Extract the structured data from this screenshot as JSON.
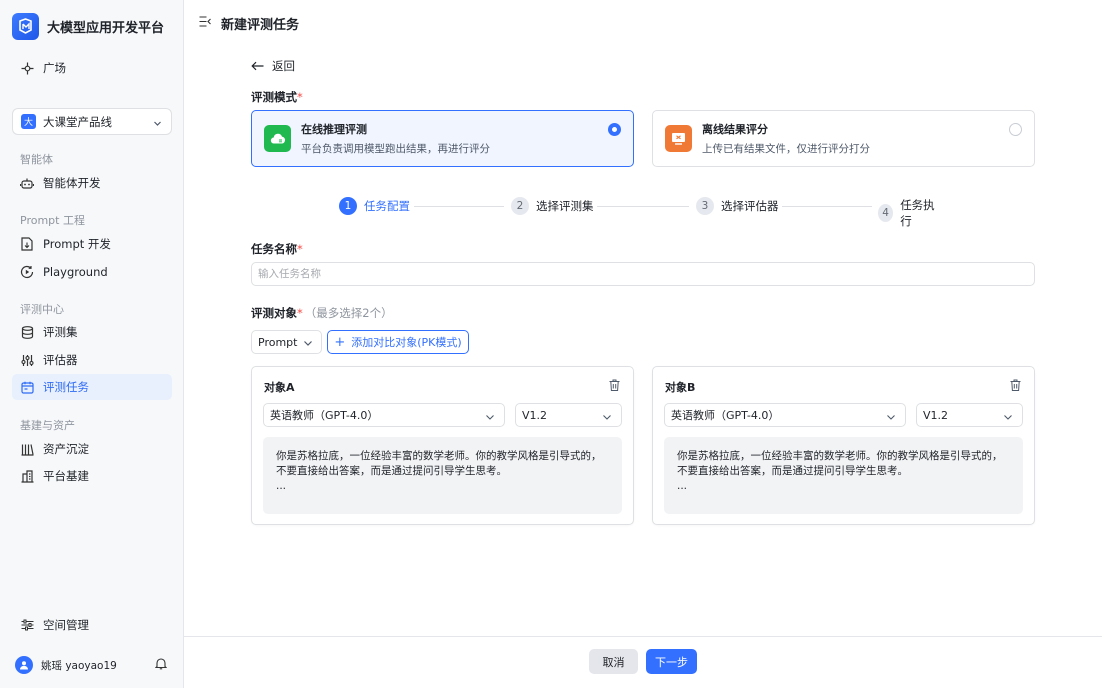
{
  "app": {
    "title": "大模型应用开发平台"
  },
  "colors": {
    "accent": "#3370ff",
    "online_icon": "#1fb950",
    "offline_icon": "#f07a35",
    "required": "#f54a45"
  },
  "sidebar": {
    "top_item": {
      "label": "广场",
      "icon": "plaza-icon"
    },
    "workspace": {
      "badge": "大",
      "label": "大课堂产品线"
    },
    "sections": [
      {
        "label": "智能体",
        "items": [
          {
            "label": "智能体开发",
            "icon": "robot-icon"
          }
        ]
      },
      {
        "label": "Prompt 工程",
        "items": [
          {
            "label": "Prompt 开发",
            "icon": "file-icon"
          },
          {
            "label": "Playground",
            "icon": "playground-icon"
          }
        ]
      },
      {
        "label": "评测中心",
        "items": [
          {
            "label": "评测集",
            "icon": "database-icon"
          },
          {
            "label": "评估器",
            "icon": "sliders-icon"
          },
          {
            "label": "评测任务",
            "icon": "calendar-icon",
            "active": true
          }
        ]
      },
      {
        "label": "基建与资产",
        "items": [
          {
            "label": "资产沉淀",
            "icon": "library-icon"
          },
          {
            "label": "平台基建",
            "icon": "building-icon"
          }
        ]
      }
    ],
    "space_mgmt": "空间管理",
    "user": {
      "name": "姚瑶 yaoyao19"
    }
  },
  "header": {
    "title": "新建评测任务"
  },
  "main": {
    "back_label": "返回",
    "mode_label": "评测模式",
    "modes": [
      {
        "title": "在线推理评测",
        "desc": "平台负责调用模型跑出结果，再进行评分",
        "selected": true
      },
      {
        "title": "离线结果评分",
        "desc": "上传已有结果文件，仅进行评分打分",
        "selected": false
      }
    ],
    "steps": [
      {
        "num": "1",
        "label": "任务配置",
        "active": true
      },
      {
        "num": "2",
        "label": "选择评测集",
        "active": false
      },
      {
        "num": "3",
        "label": "选择评估器",
        "active": false
      },
      {
        "num": "4",
        "label": "任务执行",
        "active": false
      }
    ],
    "task_name": {
      "label": "任务名称",
      "placeholder": "输入任务名称",
      "value": ""
    },
    "target": {
      "label": "评测对象",
      "hint": "（最多选择2个）",
      "type_select": "Prompt",
      "add_button": "添加对比对象(PK模式)"
    },
    "objects": [
      {
        "title": "对象A",
        "model": "英语教师（GPT-4.0）",
        "version": "V1.2",
        "prompt_lines": [
          "你是苏格拉底，一位经验丰富的数学老师。你的教学风格是引导式的，",
          "不要直接给出答案，而是通过提问引导学生思考。",
          "..."
        ]
      },
      {
        "title": "对象B",
        "model": "英语教师（GPT-4.0）",
        "version": "V1.2",
        "prompt_lines": [
          "你是苏格拉底，一位经验丰富的数学老师。你的教学风格是引导式的，",
          "不要直接给出答案，而是通过提问引导学生思考。",
          "..."
        ]
      }
    ]
  },
  "footer": {
    "cancel_label": "取消",
    "next_label": "下一步"
  }
}
